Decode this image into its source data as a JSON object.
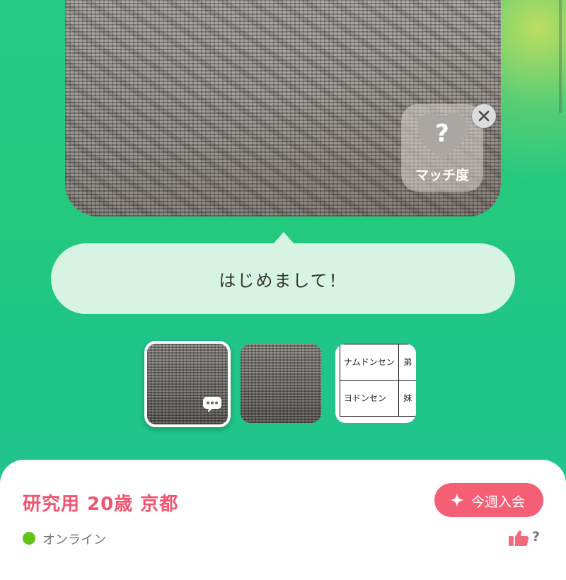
{
  "match": {
    "question_mark": "?",
    "label": "マッチ度",
    "icon": "heart-icon",
    "close_icon": "close-icon"
  },
  "bubble": {
    "message": "はじめまして！"
  },
  "thumbnails": {
    "chat_icon": "chat-bubble-icon",
    "table": [
      {
        "name": "ナムドンセン",
        "relation": "弟"
      },
      {
        "name": "ヨドンセン",
        "relation": "妹"
      }
    ]
  },
  "profile": {
    "name_line": "研究用 20歳 京都",
    "badge_label": "今週入会",
    "badge_icon": "sparkle-icon",
    "status": "オンライン",
    "status_color": "#5fc417",
    "like_icon": "thumbs-up-icon",
    "like_count": "?"
  },
  "colors": {
    "accent": "#f55f76",
    "name_color": "#f0546f",
    "background": "#23c97d",
    "bubble": "#d6f3e3"
  }
}
